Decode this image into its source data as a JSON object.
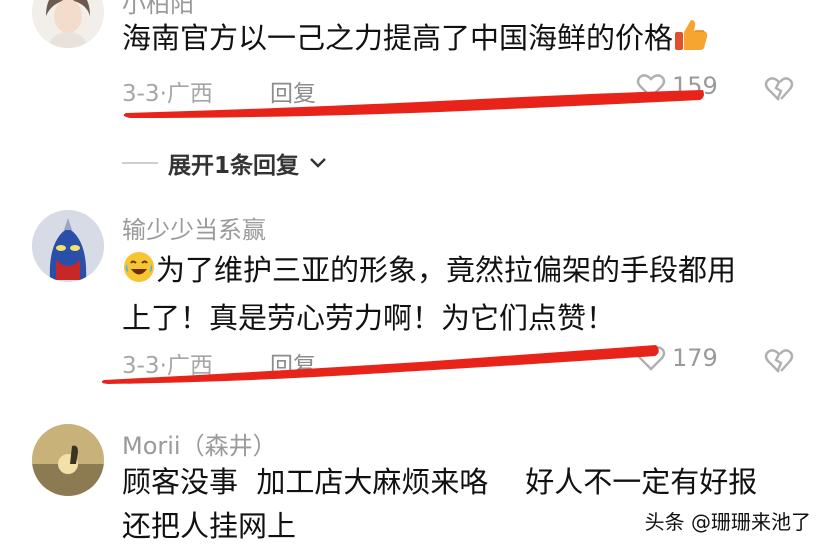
{
  "comments": [
    {
      "username": "小柏阳",
      "text": "海南官方以一己之力提高了中国海鲜的价格",
      "emoji": "thumbs-up",
      "date": "3-3",
      "location": "广西",
      "reply_label": "回复",
      "likes": "159",
      "replies_toggle": "展开1条回复"
    },
    {
      "username": "输少少当系赢",
      "emoji": "tears-of-joy",
      "text_line1": "为了维护三亚的形象，竟然拉偏架的手段都用",
      "text_line2": "上了！真是劳心劳力啊！为它们点赞！",
      "date": "3-3",
      "location": "广西",
      "reply_label": "回复",
      "likes": "179"
    },
    {
      "username": "Morii（森井）",
      "text_line1": "顾客没事  加工店大麻烦来咯    好人不一定有好报",
      "text_line2": "还把人挂网上"
    }
  ],
  "separator": "·",
  "watermark": "头条 @珊珊来池了",
  "colors": {
    "annotation_red": "#e8241a",
    "meta_gray": "#a6a6a6"
  }
}
